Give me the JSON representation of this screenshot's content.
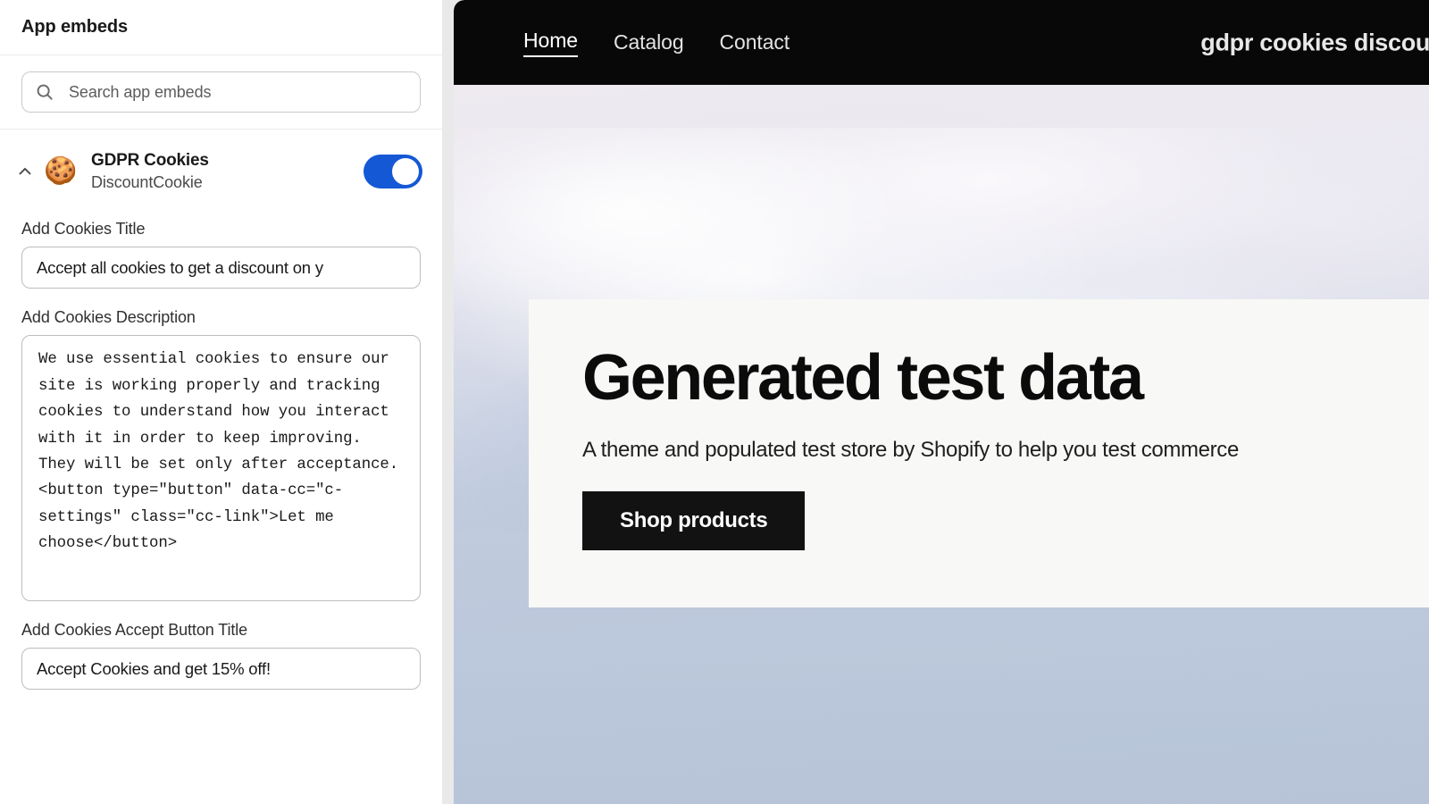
{
  "sidebar": {
    "title": "App embeds",
    "search": {
      "placeholder": "Search app embeds",
      "icon": "search-icon"
    },
    "app": {
      "name": "GDPR Cookies",
      "subtitle": "DiscountCookie",
      "icon": "cookie-icon",
      "icon_glyph": "🍪",
      "collapse_icon": "chevron-up-icon",
      "enabled": true,
      "toggle_color": "#1558d6"
    },
    "fields": [
      {
        "label": "Add Cookies Title",
        "type": "text",
        "value": "Accept all cookies to get a discount on y"
      },
      {
        "label": "Add Cookies Description",
        "type": "textarea",
        "value": "We use essential cookies to ensure our site is working properly and tracking cookies to understand how you interact with it in order to keep improving. They will be set only after acceptance.<button type=\"button\" data-cc=\"c-settings\" class=\"cc-link\">Let me choose</button>"
      },
      {
        "label": "Add Cookies Accept Button Title",
        "type": "text",
        "value": "Accept Cookies and get 15% off!"
      }
    ]
  },
  "preview": {
    "nav": {
      "links": [
        {
          "label": "Home",
          "active": true
        },
        {
          "label": "Catalog",
          "active": false
        },
        {
          "label": "Contact",
          "active": false
        }
      ],
      "store_name": "gdpr cookies discount",
      "background_color": "#080808"
    },
    "hero": {
      "title": "Generated test data",
      "subtitle": "A theme and populated test store by Shopify to help you test commerce",
      "cta_label": "Shop products",
      "card_color": "#f8f8f6",
      "cta_color": "#121212"
    }
  }
}
